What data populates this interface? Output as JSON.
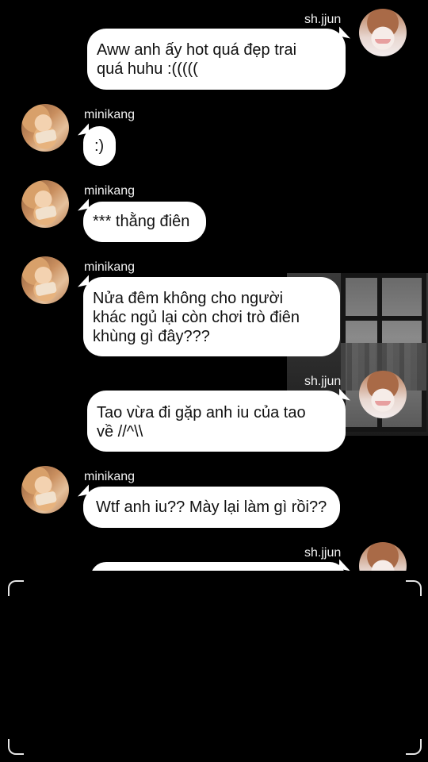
{
  "participants": {
    "sender": "sh.jjun",
    "receiver": "minikang"
  },
  "messages": [
    {
      "from": "sh.jjun",
      "text": " Aww anh ấy hot quá đẹp trai\nquá huhu :((((("
    },
    {
      "from": "minikang",
      "text": ":)"
    },
    {
      "from": "minikang",
      "text": "*** thằng điên"
    },
    {
      "from": "minikang",
      "text": " Nửa đêm không cho người\nkhác ngủ lại còn chơi trò điên\nkhùng gì đây???"
    },
    {
      "from": "sh.jjun",
      "text": " Tao vừa đi gặp anh iu của tao\nvề //^\\\\"
    },
    {
      "from": "minikang",
      "text": "Wtf anh iu?? Mày lại làm gì rồi??"
    },
    {
      "from": "sh.jjun",
      "text": ""
    }
  ],
  "icons": {
    "avatar_sender": "avatar-photo",
    "avatar_receiver": "avatar-photo",
    "viewfinder": "corner-brackets"
  }
}
